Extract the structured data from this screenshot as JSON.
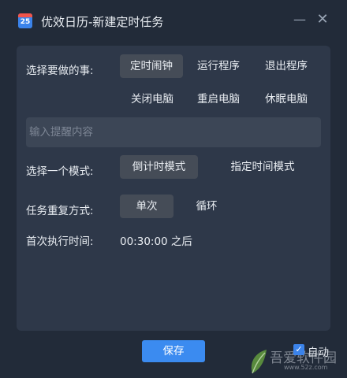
{
  "window": {
    "title": "优效日历-新建定时任务",
    "icon_number": "25",
    "minimize_glyph": "—",
    "close_glyph": "✕"
  },
  "task": {
    "label": "选择要做的事:",
    "options": [
      "定时闹钟",
      "运行程序",
      "退出程序",
      "关闭电脑",
      "重启电脑",
      "休眠电脑"
    ],
    "selected": "定时闹钟"
  },
  "reminder": {
    "placeholder": "输入提醒内容",
    "value": ""
  },
  "mode": {
    "label": "选择一个模式:",
    "options": [
      "倒计时模式",
      "指定时间模式"
    ],
    "selected": "倒计时模式"
  },
  "repeat": {
    "label": "任务重复方式:",
    "options": [
      "单次",
      "循环"
    ],
    "selected": "单次"
  },
  "first_run": {
    "label": "首次执行时间:",
    "value": "00:30:00 之后"
  },
  "footer": {
    "save_label": "保存",
    "autostart_label": "自动",
    "autostart_checked": true
  },
  "watermark": {
    "text": "吾爱软件园",
    "url": "www.52z.com"
  },
  "colors": {
    "background": "#222b39",
    "panel": "#2e3849",
    "selected_option": "#454c57",
    "accent": "#3b8bf0"
  }
}
